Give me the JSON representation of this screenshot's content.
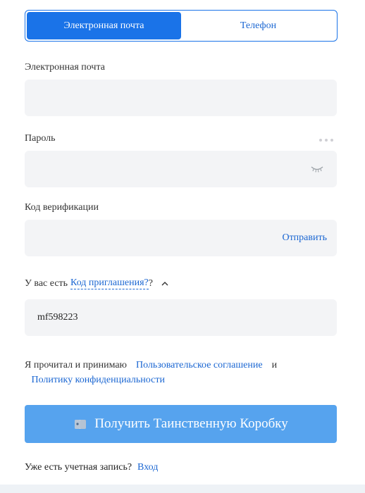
{
  "tabs": [
    {
      "label": "Электронная почта",
      "active": true
    },
    {
      "label": "Телефон",
      "active": false
    }
  ],
  "email": {
    "label": "Электронная почта",
    "value": "",
    "placeholder": ""
  },
  "password": {
    "label": "Пароль",
    "value": "",
    "placeholder": "",
    "icon": "eye-closed-icon"
  },
  "verification": {
    "label": "Код верификации",
    "value": "",
    "placeholder": "",
    "send_label": "Отправить"
  },
  "invite": {
    "prefix": "У вас есть",
    "link": "Код приглашения?",
    "suffix": "?",
    "value": "mf598223"
  },
  "agreement": {
    "text": "Я прочитал и принимаю",
    "terms_link": "Пользовательское соглашение",
    "and": "и",
    "privacy_link": "Политику конфиденциальности"
  },
  "cta": {
    "label": "Получить Таинственную Коробку",
    "icon": "mystery-box-icon"
  },
  "login": {
    "text": "Уже есть учетная запись?",
    "link": "Вход"
  },
  "colors": {
    "primary": "#1a73e8",
    "link": "#1a66d2",
    "cta": "#56a3ee",
    "field_bg": "#f3f4f6"
  }
}
